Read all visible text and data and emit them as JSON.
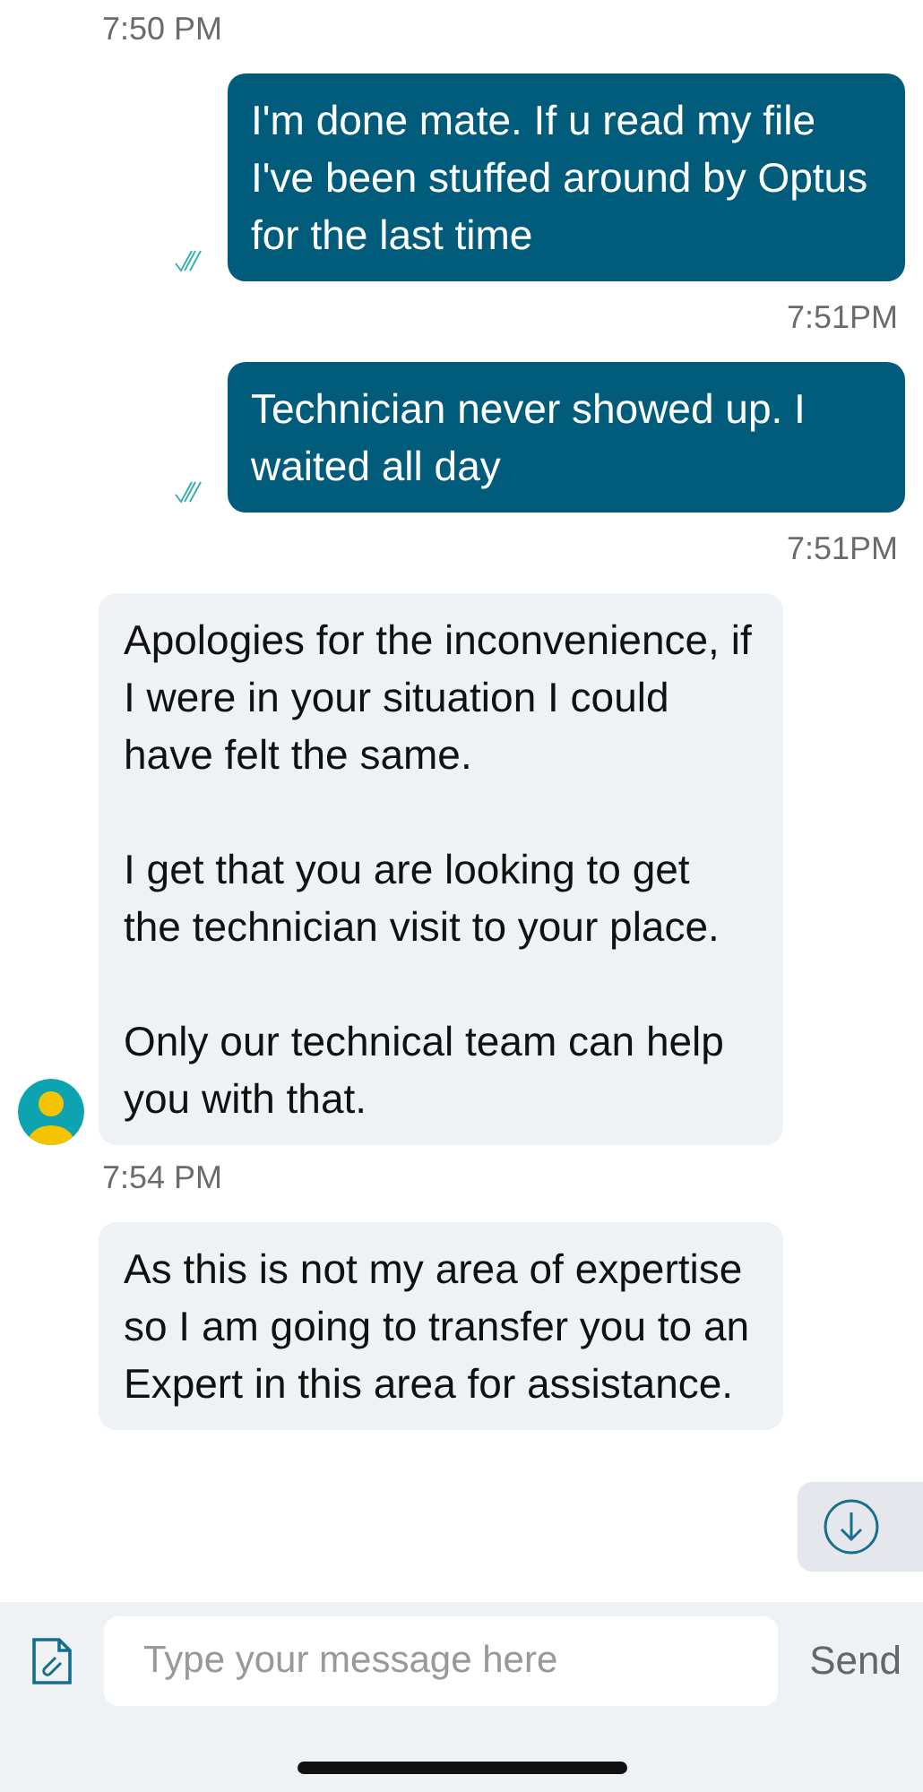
{
  "messages": [
    {
      "kind": "received-time",
      "text": "7:50 PM"
    },
    {
      "kind": "outgoing",
      "paragraphs": [
        "I'm done mate. If u read my file I've been stuffed around by Optus for the last time"
      ]
    },
    {
      "kind": "sent-time",
      "text": "7:51PM"
    },
    {
      "kind": "outgoing",
      "paragraphs": [
        "Technician never showed up. I waited all day"
      ]
    },
    {
      "kind": "sent-time",
      "text": "7:51PM"
    },
    {
      "kind": "incoming",
      "avatar": true,
      "paragraphs": [
        "Apologies for the inconvenience, if I were in your situation I could have felt the same.",
        "I get that you are looking to get the technician visit to your place.",
        "Only our technical team can help you with that."
      ]
    },
    {
      "kind": "received-time",
      "text": "7:54 PM"
    },
    {
      "kind": "incoming",
      "avatar": false,
      "paragraphs": [
        "As this is not my area of expertise so I am going to transfer you to an Expert in this area for assistance."
      ]
    }
  ],
  "composer": {
    "placeholder": "Type your message here",
    "send": "Send"
  }
}
